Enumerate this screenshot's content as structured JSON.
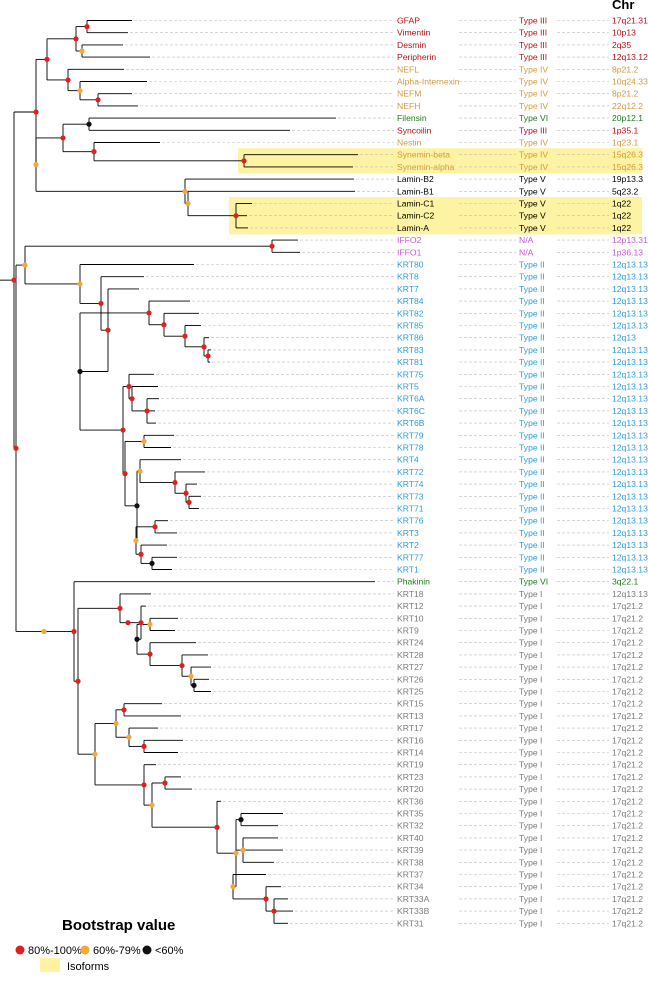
{
  "header": {
    "chr_label": "Chr"
  },
  "colors": {
    "type_III": "#b3121a",
    "type_IV": "#d39a3c",
    "type_V": "#000000",
    "type_VI": "#1e7a1e",
    "na": "#c95ad6",
    "type_II": "#2a9fd8",
    "type_I": "#7a7a7a",
    "branch": "#000000",
    "dash": "#bdbdbd",
    "isoform_highlight": "#fdf3a3",
    "node_high": "#e0201e",
    "node_mid": "#f5a83a",
    "node_low": "#111111"
  },
  "genes": [
    {
      "name": "GFAP",
      "type": "Type III",
      "chr": "17q21.31",
      "group": "type_III"
    },
    {
      "name": "Vimentin",
      "type": "Type III",
      "chr": "10p13",
      "group": "type_III"
    },
    {
      "name": "Desmin",
      "type": "Type III",
      "chr": "2q35",
      "group": "type_III"
    },
    {
      "name": "Peripherin",
      "type": "Type III",
      "chr": "12q13.12",
      "group": "type_III"
    },
    {
      "name": "NEFL",
      "type": "Type IV",
      "chr": "8p21.2",
      "group": "type_IV"
    },
    {
      "name": "Alpha-Internexin",
      "type": "Type IV",
      "chr": "10q24.33",
      "group": "type_IV"
    },
    {
      "name": "NEFM",
      "type": "Type IV",
      "chr": "8p21.2",
      "group": "type_IV"
    },
    {
      "name": "NEFH",
      "type": "Type IV",
      "chr": "22q12.2",
      "group": "type_IV"
    },
    {
      "name": "Filensin",
      "type": "Type VI",
      "chr": "20p12.1",
      "group": "type_VI"
    },
    {
      "name": "Syncoilin",
      "type": "Type III",
      "chr": "1p35.1",
      "group": "type_III"
    },
    {
      "name": "Nestin",
      "type": "Type IV",
      "chr": "1q23.1",
      "group": "type_IV"
    },
    {
      "name": "Synemin-beta",
      "type": "Type IV",
      "chr": "15q26.3",
      "group": "type_IV"
    },
    {
      "name": "Synemin-alpha",
      "type": "Type IV",
      "chr": "15q26.3",
      "group": "type_IV"
    },
    {
      "name": "Lamin-B2",
      "type": "Type V",
      "chr": "19p13.3",
      "group": "type_V"
    },
    {
      "name": "Lamin-B1",
      "type": "Type V",
      "chr": "5q23.2",
      "group": "type_V"
    },
    {
      "name": "Lamin-C1",
      "type": "Type V",
      "chr": "1q22",
      "group": "type_V"
    },
    {
      "name": "Lamin-C2",
      "type": "Type V",
      "chr": "1q22",
      "group": "type_V"
    },
    {
      "name": "Lamin-A",
      "type": "Type V",
      "chr": "1q22",
      "group": "type_V"
    },
    {
      "name": "IFFO2",
      "type": "N/A",
      "chr": "12p13.31",
      "group": "na"
    },
    {
      "name": "IFFO1",
      "type": "N/A",
      "chr": "1p36.13",
      "group": "na"
    },
    {
      "name": "KRT80",
      "type": "Type II",
      "chr": "12q13.13",
      "group": "type_II"
    },
    {
      "name": "KRT8",
      "type": "Type II",
      "chr": "12q13.13",
      "group": "type_II"
    },
    {
      "name": "KRT7",
      "type": "Type II",
      "chr": "12q13.13",
      "group": "type_II"
    },
    {
      "name": "KRT84",
      "type": "Type II",
      "chr": "12q13.13",
      "group": "type_II"
    },
    {
      "name": "KRT82",
      "type": "Type II",
      "chr": "12q13.13",
      "group": "type_II"
    },
    {
      "name": "KRT85",
      "type": "Type II",
      "chr": "12q13.13",
      "group": "type_II"
    },
    {
      "name": "KRT86",
      "type": "Type II",
      "chr": "12q13",
      "group": "type_II"
    },
    {
      "name": "KRT83",
      "type": "Type II",
      "chr": "12q13.13",
      "group": "type_II"
    },
    {
      "name": "KRT81",
      "type": "Type II",
      "chr": "12q13.13",
      "group": "type_II"
    },
    {
      "name": "KRT75",
      "type": "Type II",
      "chr": "12q13.13",
      "group": "type_II"
    },
    {
      "name": "KRT5",
      "type": "Type II",
      "chr": "12q13.13",
      "group": "type_II"
    },
    {
      "name": "KRT6A",
      "type": "Type II",
      "chr": "12q13.13",
      "group": "type_II"
    },
    {
      "name": "KRT6C",
      "type": "Type II",
      "chr": "12q13.13",
      "group": "type_II"
    },
    {
      "name": "KRT6B",
      "type": "Type II",
      "chr": "12q13.13",
      "group": "type_II"
    },
    {
      "name": "KRT79",
      "type": "Type II",
      "chr": "12q13.13",
      "group": "type_II"
    },
    {
      "name": "KRT78",
      "type": "Type II",
      "chr": "12q13.13",
      "group": "type_II"
    },
    {
      "name": "KRT4",
      "type": "Type II",
      "chr": "12q13.13",
      "group": "type_II"
    },
    {
      "name": "KRT72",
      "type": "Type II",
      "chr": "12q13.13",
      "group": "type_II"
    },
    {
      "name": "KRT74",
      "type": "Type II",
      "chr": "12q13.13",
      "group": "type_II"
    },
    {
      "name": "KRT73",
      "type": "Type II",
      "chr": "12q13.13",
      "group": "type_II"
    },
    {
      "name": "KRT71",
      "type": "Type II",
      "chr": "12q13.13",
      "group": "type_II"
    },
    {
      "name": "KRT76",
      "type": "Type II",
      "chr": "12q13.13",
      "group": "type_II"
    },
    {
      "name": "KRT3",
      "type": "Type II",
      "chr": "12q13.13",
      "group": "type_II"
    },
    {
      "name": "KRT2",
      "type": "Type II",
      "chr": "12q13.13",
      "group": "type_II"
    },
    {
      "name": "KRT77",
      "type": "Type II",
      "chr": "12q13.13",
      "group": "type_II"
    },
    {
      "name": "KRT1",
      "type": "Type II",
      "chr": "12q13.13",
      "group": "type_II"
    },
    {
      "name": "Phakinin",
      "type": "Type VI",
      "chr": "3q22.1",
      "group": "type_VI"
    },
    {
      "name": "KRT18",
      "type": "Type I",
      "chr": "12q13.13",
      "group": "type_I"
    },
    {
      "name": "KRT12",
      "type": "Type I",
      "chr": "17q21.2",
      "group": "type_I"
    },
    {
      "name": "KRT10",
      "type": "Type I",
      "chr": "17q21.2",
      "group": "type_I"
    },
    {
      "name": "KRT9",
      "type": "Type I",
      "chr": "17q21.2",
      "group": "type_I"
    },
    {
      "name": "KRT24",
      "type": "Type I",
      "chr": "17q21.2",
      "group": "type_I"
    },
    {
      "name": "KRT28",
      "type": "Type I",
      "chr": "17q21.2",
      "group": "type_I"
    },
    {
      "name": "KRT27",
      "type": "Type I",
      "chr": "17q21.2",
      "group": "type_I"
    },
    {
      "name": "KRT26",
      "type": "Type I",
      "chr": "17q21.2",
      "group": "type_I"
    },
    {
      "name": "KRT25",
      "type": "Type I",
      "chr": "17q21.2",
      "group": "type_I"
    },
    {
      "name": "KRT15",
      "type": "Type I",
      "chr": "17q21.2",
      "group": "type_I"
    },
    {
      "name": "KRT13",
      "type": "Type I",
      "chr": "17q21.2",
      "group": "type_I"
    },
    {
      "name": "KRT17",
      "type": "Type I",
      "chr": "17q21.2",
      "group": "type_I"
    },
    {
      "name": "KRT16",
      "type": "Type I",
      "chr": "17q21.2",
      "group": "type_I"
    },
    {
      "name": "KRT14",
      "type": "Type I",
      "chr": "17q21.2",
      "group": "type_I"
    },
    {
      "name": "KRT19",
      "type": "Type I",
      "chr": "17q21.2",
      "group": "type_I"
    },
    {
      "name": "KRT23",
      "type": "Type I",
      "chr": "17q21.2",
      "group": "type_I"
    },
    {
      "name": "KRT20",
      "type": "Type I",
      "chr": "17q21.2",
      "group": "type_I"
    },
    {
      "name": "KRT36",
      "type": "Type I",
      "chr": "17q21.2",
      "group": "type_I"
    },
    {
      "name": "KRT35",
      "type": "Type I",
      "chr": "17q21.2",
      "group": "type_I"
    },
    {
      "name": "KRT32",
      "type": "Type I",
      "chr": "17q21.2",
      "group": "type_I"
    },
    {
      "name": "KRT40",
      "type": "Type I",
      "chr": "17q21.2",
      "group": "type_I"
    },
    {
      "name": "KRT39",
      "type": "Type I",
      "chr": "17q21.2",
      "group": "type_I"
    },
    {
      "name": "KRT38",
      "type": "Type I",
      "chr": "17q21.2",
      "group": "type_I"
    },
    {
      "name": "KRT37",
      "type": "Type I",
      "chr": "17q21.2",
      "group": "type_I"
    },
    {
      "name": "KRT34",
      "type": "Type I",
      "chr": "17q21.2",
      "group": "type_I"
    },
    {
      "name": "KRT33A",
      "type": "Type I",
      "chr": "17q21.2",
      "group": "type_I"
    },
    {
      "name": "KRT33B",
      "type": "Type I",
      "chr": "17q21.2",
      "group": "type_I"
    },
    {
      "name": "KRT31",
      "type": "Type I",
      "chr": "17q21.2",
      "group": "type_I"
    }
  ],
  "isoform_groups": [
    [
      "Synemin-beta",
      "Synemin-alpha"
    ],
    [
      "Lamin-C1",
      "Lamin-C2",
      "Lamin-A"
    ]
  ],
  "legend": {
    "title": "Bootstrap value",
    "high_label": "80%-100%",
    "mid_label": "60%-79%",
    "low_label": "<60%",
    "isoform_label": "Isoforms"
  }
}
